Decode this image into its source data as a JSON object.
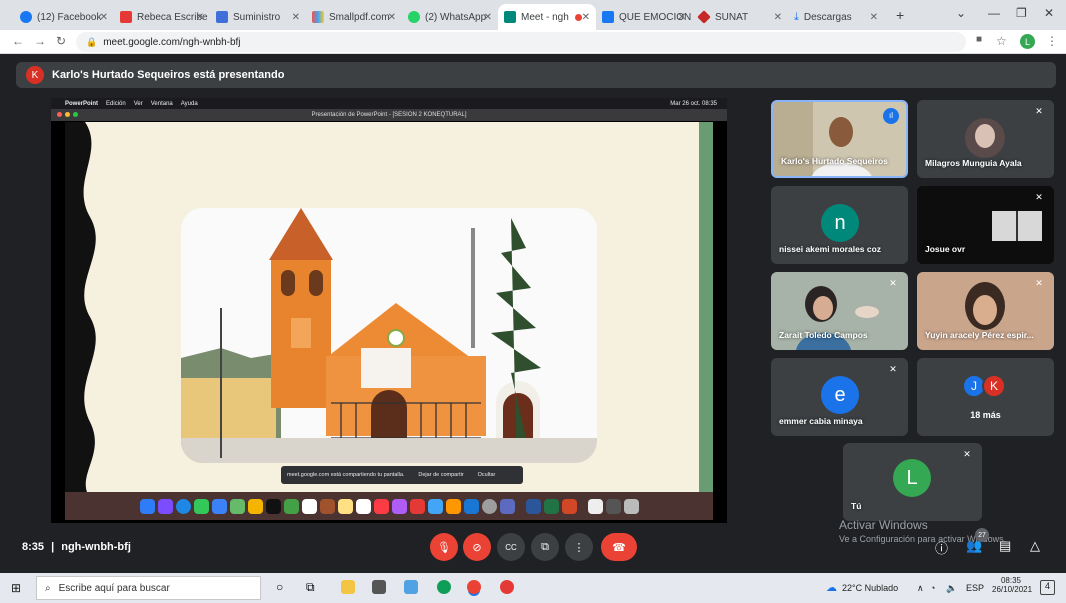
{
  "browser": {
    "tabs": [
      {
        "label": "(12) Facebook",
        "color": "#1877f2"
      },
      {
        "label": "Rebeca Escribe",
        "color": "#e53935"
      },
      {
        "label": "Suministro",
        "color": "#3f6fd8"
      },
      {
        "label": "Smallpdf.com",
        "color": "#ef5350"
      },
      {
        "label": "(2) WhatsApp",
        "color": "#25d366"
      },
      {
        "label": "Meet - ngh",
        "color": "#00897b",
        "active": true
      },
      {
        "label": "QUE EMOCION",
        "color": "#1877f2"
      },
      {
        "label": "SUNAT",
        "color": "#c62828"
      },
      {
        "label": "Descargas",
        "color": "#1a73e8"
      }
    ],
    "url": "meet.google.com/ngh-wnbh-bfj",
    "profile_initial": "L"
  },
  "meet": {
    "presenting_initial": "K",
    "presenting_text": "Karlo's Hurtado Sequeiros está presentando",
    "meeting_time": "8:35",
    "meeting_code": "ngh-wnbh-bfj",
    "participant_count": "27",
    "more_label": "18 más",
    "more_initials": [
      "J",
      "K"
    ],
    "watermark_title": "Activar Windows",
    "watermark_sub": "Ve a Configuración para activar Windows."
  },
  "participants": [
    {
      "name": "Karlo's Hurtado Sequeiros",
      "type": "video",
      "speaking": true
    },
    {
      "name": "Milagros Munguia Ayala",
      "type": "video",
      "muted": true
    },
    {
      "name": "nissei akemi morales coz",
      "type": "letter",
      "letter": "n",
      "color": "#00897b"
    },
    {
      "name": "Josue ovr",
      "type": "video",
      "muted": true
    },
    {
      "name": "Zarait Toledo Campos",
      "type": "video",
      "muted": true
    },
    {
      "name": "Yuyin aracely Pérez espir...",
      "type": "video",
      "muted": true
    },
    {
      "name": "emmer cabia minaya",
      "type": "letter",
      "letter": "e",
      "color": "#1a73e8",
      "muted": true
    },
    {
      "name": "Tú",
      "type": "letter",
      "letter": "L",
      "color": "#34a853",
      "muted": true
    }
  ],
  "presentation": {
    "menu_app": "PowerPoint",
    "menu_items": [
      "Edición",
      "Ver",
      "Ventana",
      "Ayuda"
    ],
    "menu_clock": "Mar 26 oct. 08:35",
    "window_title": "Presentación de PowerPoint - [SESION 2 KONEQTURAL]",
    "share_text": "meet.google.com está compartiendo tu pantalla.",
    "stop_share": "Dejar de compartir",
    "hide": "Ocultar"
  },
  "taskbar": {
    "search_placeholder": "Escribe aquí para buscar",
    "weather": "22°C Nublado",
    "lang": "ESP",
    "time": "08:35",
    "date": "26/10/2021",
    "notifications": "4"
  }
}
